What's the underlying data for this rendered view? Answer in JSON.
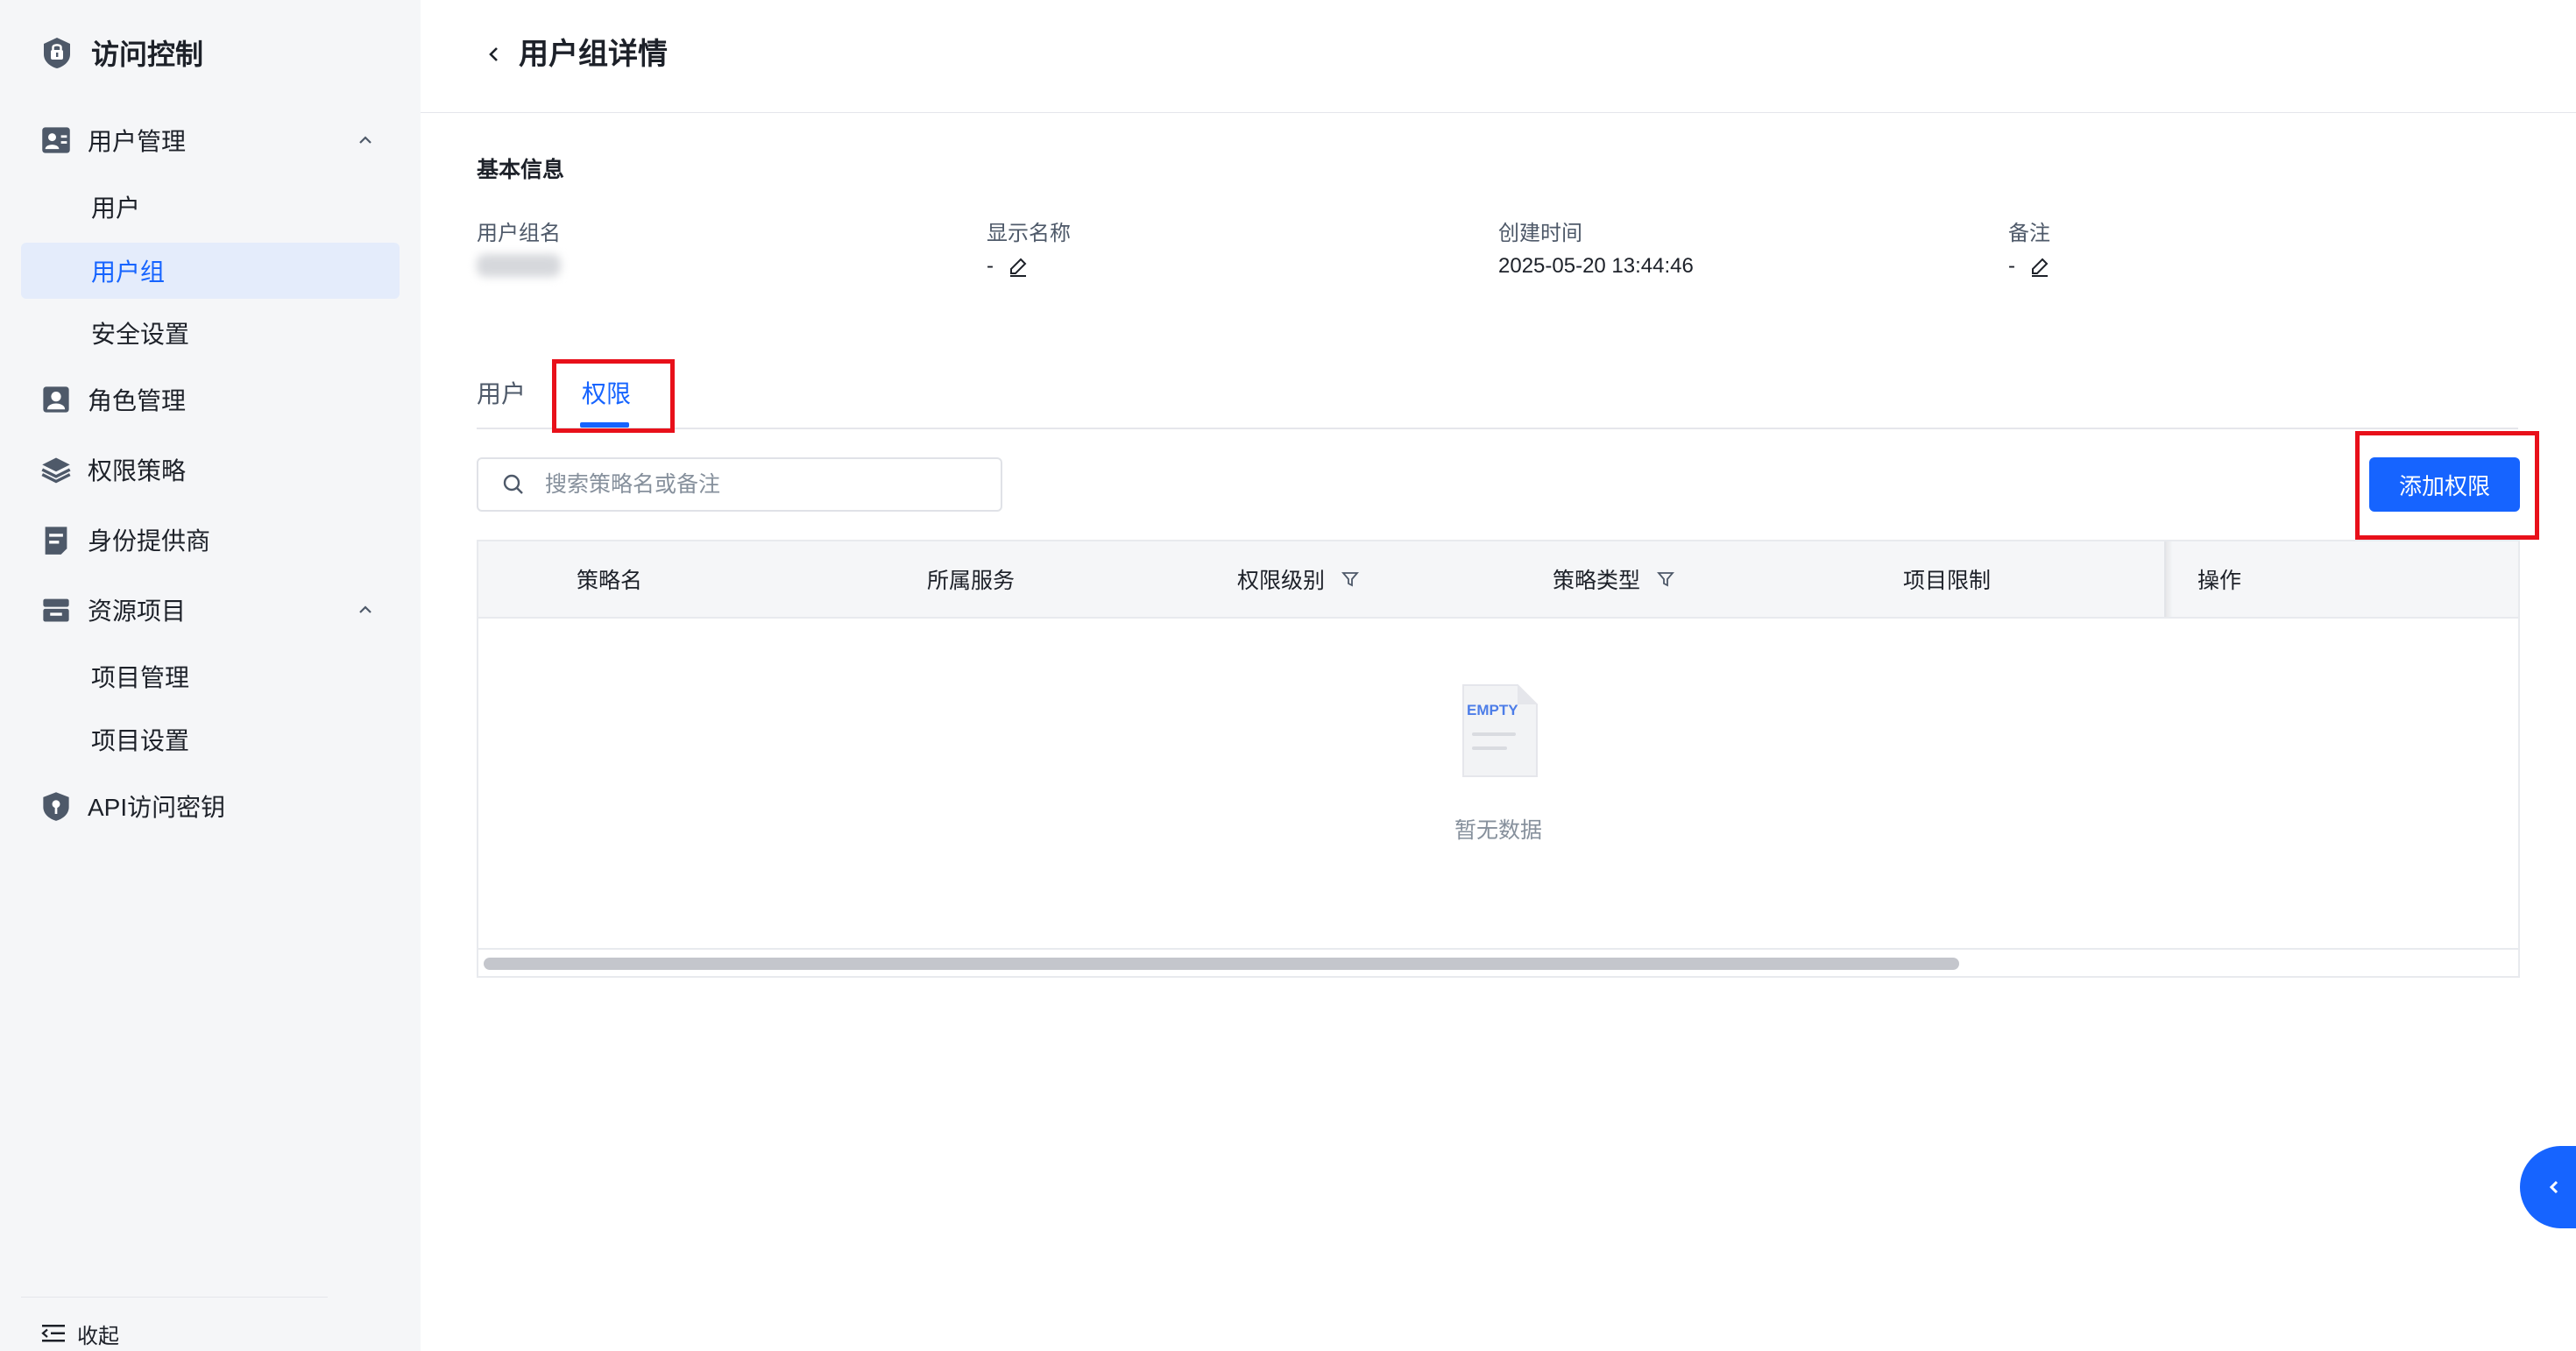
{
  "sidebar": {
    "title": "访问控制",
    "groups": [
      {
        "label": "用户管理",
        "expanded": true,
        "icon": "user-management-icon",
        "items": [
          {
            "label": "用户"
          },
          {
            "label": "用户组",
            "active": true
          },
          {
            "label": "安全设置"
          }
        ]
      },
      {
        "label": "角色管理",
        "icon": "role-icon"
      },
      {
        "label": "权限策略",
        "icon": "layers-icon"
      },
      {
        "label": "身份提供商",
        "icon": "identity-provider-icon"
      },
      {
        "label": "资源项目",
        "expanded": true,
        "icon": "resource-project-icon",
        "items": [
          {
            "label": "项目管理"
          },
          {
            "label": "项目设置"
          }
        ]
      },
      {
        "label": "API访问密钥",
        "icon": "shield-key-icon"
      }
    ],
    "collapse_label": "收起"
  },
  "header": {
    "title": "用户组详情"
  },
  "basic_info": {
    "title": "基本信息",
    "fields": [
      {
        "label": "用户组名",
        "value": ""
      },
      {
        "label": "显示名称",
        "value": "-"
      },
      {
        "label": "创建时间",
        "value": "2025-05-20 13:44:46"
      },
      {
        "label": "备注",
        "value": "-"
      }
    ]
  },
  "tabs": [
    {
      "label": "用户"
    },
    {
      "label": "权限",
      "active": true
    }
  ],
  "search": {
    "placeholder": "搜索策略名或备注",
    "value": ""
  },
  "add_button": {
    "label": "添加权限"
  },
  "table": {
    "columns": [
      {
        "label": "策略名"
      },
      {
        "label": "所属服务"
      },
      {
        "label": "权限级别",
        "filter": true
      },
      {
        "label": "策略类型",
        "filter": true
      },
      {
        "label": "项目限制"
      },
      {
        "label": "操作"
      }
    ],
    "rows": [],
    "empty_text": "暂无数据",
    "empty_image_text": "EMPTY"
  },
  "colors": {
    "primary": "#1664ff",
    "highlight": "#e8101a",
    "sidebar_bg": "#f5f6f8"
  }
}
